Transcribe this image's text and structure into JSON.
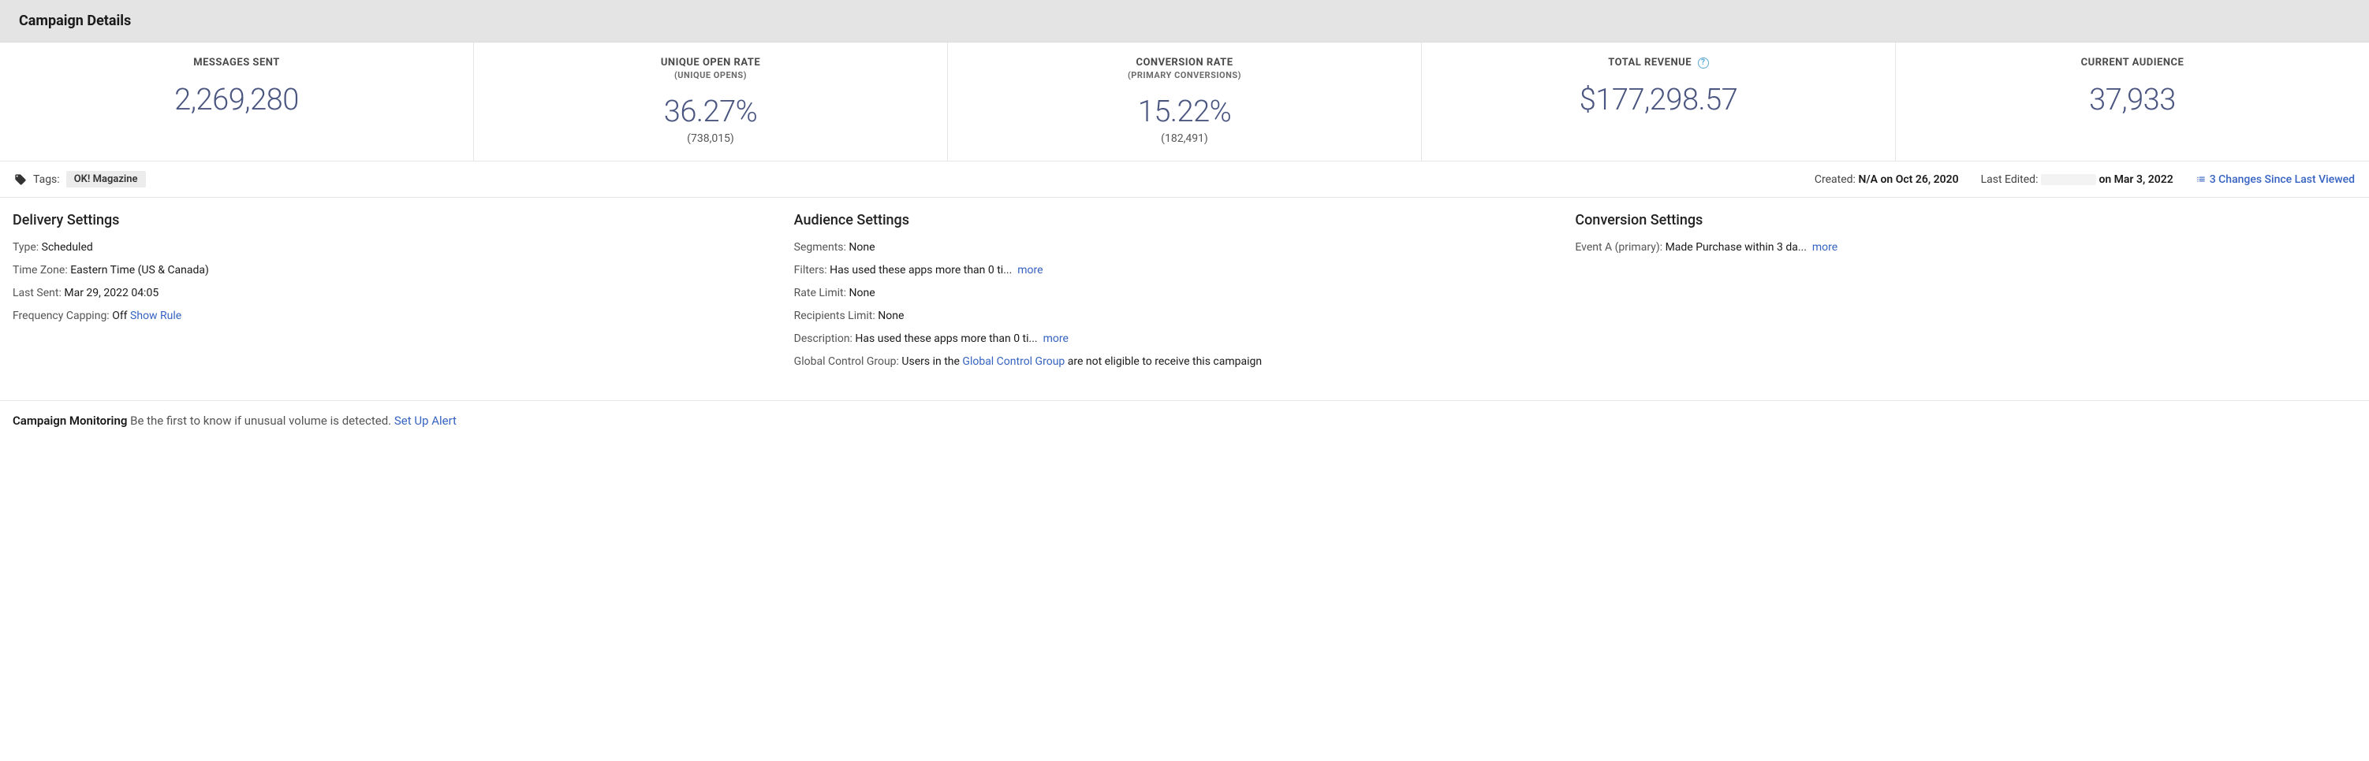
{
  "header": {
    "title": "Campaign Details"
  },
  "metrics": {
    "messages_sent": {
      "title": "MESSAGES SENT",
      "value": "2,269,280"
    },
    "open_rate": {
      "title": "UNIQUE OPEN RATE",
      "subtitle": "(UNIQUE OPENS)",
      "value": "36.27%",
      "extra": "(738,015)"
    },
    "conversion_rate": {
      "title": "CONVERSION RATE",
      "subtitle": "(PRIMARY CONVERSIONS)",
      "value": "15.22%",
      "extra": "(182,491)"
    },
    "total_revenue": {
      "title": "TOTAL REVENUE",
      "value": "$177,298.57"
    },
    "current_audience": {
      "title": "CURRENT AUDIENCE",
      "value": "37,933"
    }
  },
  "meta": {
    "tags_label": "Tags:",
    "tag_value": "OK! Magazine",
    "created_label": "Created:",
    "created_value": "N/A on Oct 26, 2020",
    "last_edited_label": "Last Edited:",
    "last_edited_date": "on Mar 3, 2022",
    "changes_text": "3 Changes Since Last Viewed"
  },
  "delivery": {
    "heading": "Delivery Settings",
    "type_label": "Type:",
    "type_value": "Scheduled",
    "tz_label": "Time Zone:",
    "tz_value": "Eastern Time (US & Canada)",
    "last_sent_label": "Last Sent:",
    "last_sent_value": "Mar 29, 2022 04:05",
    "freq_label": "Frequency Capping:",
    "freq_value": "Off",
    "show_rule": "Show Rule"
  },
  "audience": {
    "heading": "Audience Settings",
    "segments_label": "Segments:",
    "segments_value": "None",
    "filters_label": "Filters:",
    "filters_value": "Has used these apps more than 0 ti...",
    "filters_more": "more",
    "rate_limit_label": "Rate Limit:",
    "rate_limit_value": "None",
    "recipients_limit_label": "Recipients Limit:",
    "recipients_limit_value": "None",
    "description_label": "Description:",
    "description_value": "Has used these apps more than 0 ti...",
    "description_more": "more",
    "gcg_label": "Global Control Group:",
    "gcg_prefix": "Users in the",
    "gcg_link": "Global Control Group",
    "gcg_suffix": "are not eligible to receive this campaign"
  },
  "conversion": {
    "heading": "Conversion Settings",
    "event_label": "Event A (primary):",
    "event_value": "Made Purchase within 3 da...",
    "event_more": "more"
  },
  "monitoring": {
    "title": "Campaign Monitoring",
    "text": "Be the first to know if unusual volume is detected.",
    "link": "Set Up Alert"
  }
}
